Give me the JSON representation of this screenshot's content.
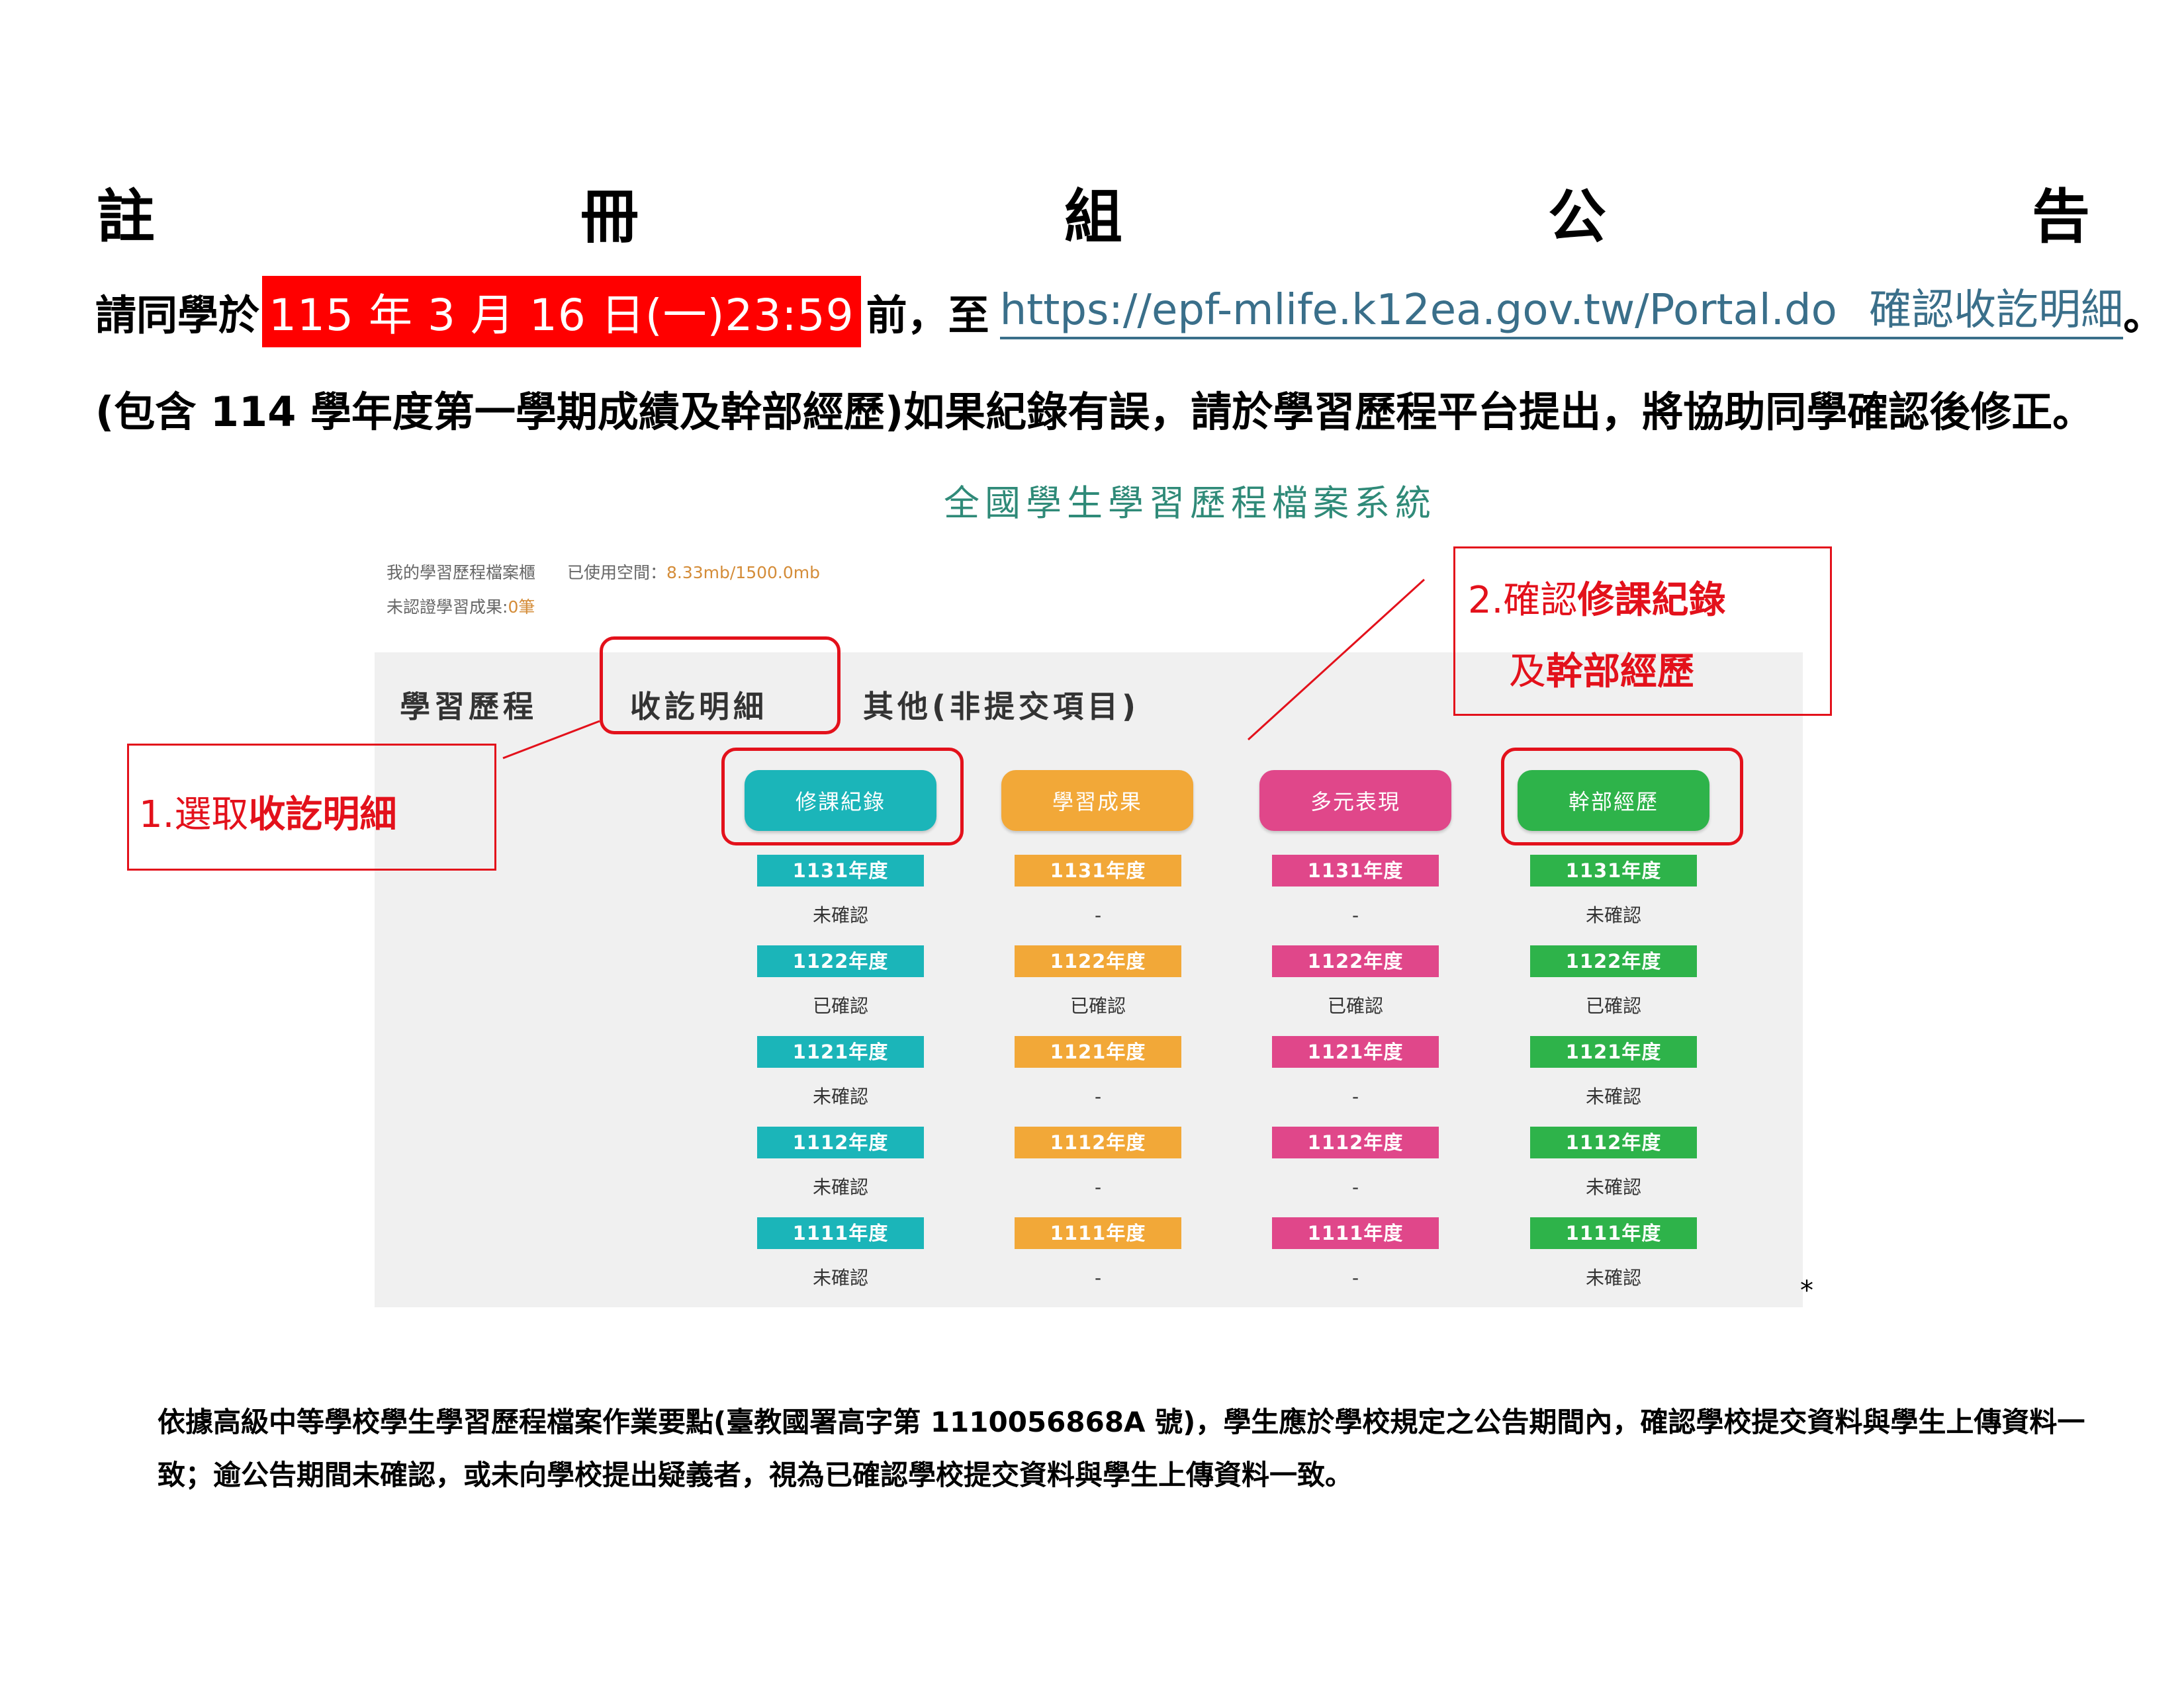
{
  "announcement": {
    "title_chars": [
      "註",
      "冊",
      "組",
      "公",
      "告"
    ],
    "line1_prefix": "請同學於",
    "line1_deadline": "115 年 3 月 16 日(一)23:59",
    "line1_mid": "前，至",
    "line1_url": "https://epf-mlife.k12ea.gov.tw/Portal.do",
    "line1_action": "確認收訖明細",
    "line1_end": "。",
    "line2": "(包含 114 學年度第一學期成績及幹部經歷)如果紀錄有誤，請於學習歷程平台提出，將協助同學確認後修正。"
  },
  "system": {
    "title": "全國學生學習歷程檔案系統",
    "cabinet_label": "我的學習歷程檔案櫃",
    "space_label": "已使用空間：",
    "space_value": "8.33mb/1500.0mb",
    "unverified_label": "未認證學習成果:",
    "unverified_value": "0筆",
    "tabs": [
      "學習歷程",
      "收訖明細",
      "其他(非提交項目)"
    ],
    "columns": [
      {
        "label": "修課紀錄",
        "color": "#1bb5b9",
        "years": [
          "1131年度",
          "1122年度",
          "1121年度",
          "1112年度",
          "1111年度"
        ],
        "statuses": [
          "未確認",
          "已確認",
          "未確認",
          "未確認",
          "未確認"
        ]
      },
      {
        "label": "學習成果",
        "color": "#f2a838",
        "years": [
          "1131年度",
          "1122年度",
          "1121年度",
          "1112年度",
          "1111年度"
        ],
        "statuses": [
          "-",
          "已確認",
          "-",
          "-",
          "-"
        ]
      },
      {
        "label": "多元表現",
        "color": "#e0478a",
        "years": [
          "1131年度",
          "1122年度",
          "1121年度",
          "1112年度",
          "1111年度"
        ],
        "statuses": [
          "-",
          "已確認",
          "-",
          "-",
          "-"
        ]
      },
      {
        "label": "幹部經歷",
        "color": "#2eb34a",
        "years": [
          "1131年度",
          "1122年度",
          "1121年度",
          "1112年度",
          "1111年度"
        ],
        "statuses": [
          "未確認",
          "已確認",
          "未確認",
          "未確認",
          "未確認"
        ]
      }
    ]
  },
  "callouts": {
    "step1_prefix": "1.選取",
    "step1_bold": "收訖明細",
    "step2_prefix": "2.確認",
    "step2_bold": "修課紀錄",
    "step2b_prefix": "及",
    "step2b_bold": "幹部經歷"
  },
  "asterisk": "*",
  "footer": "依據高級中等學校學生學習歷程檔案作業要點(臺教國署高字第 1110056868A 號)，學生應於學校規定之公告期間內，確認學校提交資料與學生上傳資料一致；逾公告期間未確認，或未向學校提出疑義者，視為已確認學校提交資料與學生上傳資料一致。"
}
